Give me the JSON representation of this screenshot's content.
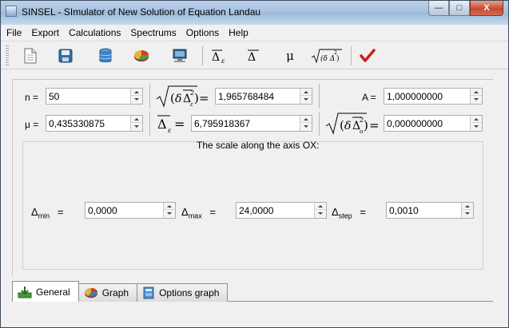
{
  "window": {
    "title": "SINSEL  - SImulator of New Solution of Equation Landau"
  },
  "titlebar_buttons": {
    "minimize": "—",
    "maximize": "□",
    "close": "X"
  },
  "menu": [
    "File",
    "Export",
    "Calculations",
    "Spectrums",
    "Options",
    "Help"
  ],
  "toolbar": {
    "icons": [
      "new-document-icon",
      "save-icon",
      "database-icon",
      "pie-chart-icon",
      "monitor-icon",
      "delta-epsilon-icon",
      "delta-icon",
      "mu-icon",
      "sqrt-delta-icon",
      "checkmark-icon"
    ],
    "mu_label": "μ"
  },
  "fields": {
    "n": {
      "label": "n =",
      "value": "50"
    },
    "sqrt_delta_delta": {
      "value": "1,965768484"
    },
    "A": {
      "label": "A =",
      "value": "1,000000000"
    },
    "mu": {
      "label": "μ =",
      "value": "0,435330875"
    },
    "delta_epsilon": {
      "value": "6,795918367"
    },
    "sqrt_delta_zero": {
      "value": "0,000000000"
    }
  },
  "scale": {
    "title": "The scale along the axis OX:",
    "min": {
      "symbol": "Δ",
      "sub": "min",
      "eq": "=",
      "value": "0,0000"
    },
    "max": {
      "symbol": "Δ",
      "sub": "max",
      "eq": "=",
      "value": "24,0000"
    },
    "step": {
      "symbol": "Δ",
      "sub": "step",
      "eq": "=",
      "value": "0,0010"
    }
  },
  "tabs": [
    {
      "label": "General",
      "icon": "download-icon",
      "active": true
    },
    {
      "label": "Graph",
      "icon": "pie-chart-icon",
      "active": false
    },
    {
      "label": "Options graph",
      "icon": "book-icon",
      "active": false
    }
  ],
  "colors": {
    "accent": "#3c7fb1",
    "check": "#d01c1c"
  }
}
